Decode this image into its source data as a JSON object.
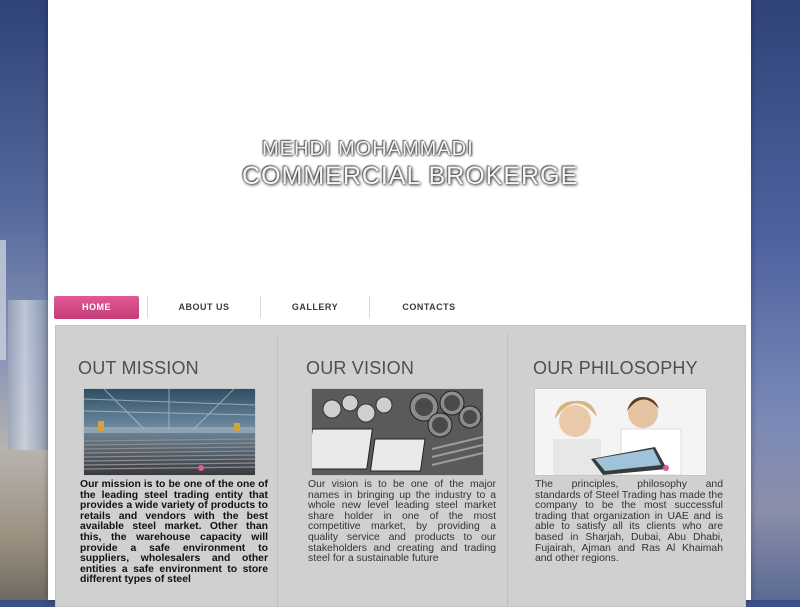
{
  "brand": {
    "line1": "MEHDI MOHAMMADI",
    "line2": "COMMERCIAL BROKERGE"
  },
  "nav": {
    "items": [
      {
        "label": "HOME",
        "active": true
      },
      {
        "label": "ABOUT US",
        "active": false
      },
      {
        "label": "GALLERY",
        "active": false
      },
      {
        "label": "CONTACTS",
        "active": false
      }
    ]
  },
  "sections": [
    {
      "title": "OUT MISSION",
      "image": "steel-warehouse-photo",
      "text": "Our mission is to be one of the one of the leading steel trading entity that provides a wide variety of products to retails and vendors with the best available steel market. Other than this, the warehouse capacity will provide a safe environment to suppliers, wholesalers and other entities a safe environment to store different types of steel"
    },
    {
      "title": "OUR VISION",
      "image": "steel-pipes-photo",
      "text": "Our vision is to be one of the major names in bringing up the industry to a whole new level leading steel market share holder in one of the most competitive market, by providing a quality service and products to our stakeholders and creating and trading steel for a sustainable future"
    },
    {
      "title": "OUR PHILOSOPHY",
      "image": "people-laptop-photo",
      "text": "The principles, philosophy and standards of Steel Trading has made the company to be the most successful trading that organization in UAE and is able to satisfy all its clients who are based in Sharjah, Dubai, Abu Dhabi, Fujairah, Ajman and Ras Al Khaimah and other regions."
    }
  ],
  "colors": {
    "accent": "#d94a88",
    "panel": "#d0d0d0",
    "heading": "#4f4f4f"
  }
}
